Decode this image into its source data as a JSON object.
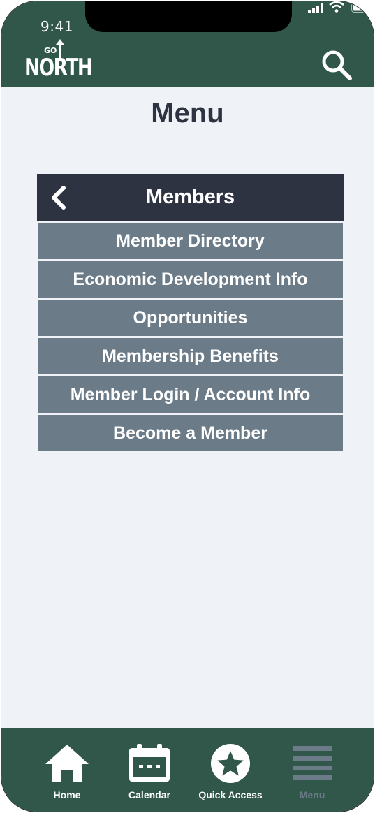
{
  "status_bar": {
    "time": "9:41"
  },
  "header": {
    "logo_small": "GO",
    "logo_main": "NORTH"
  },
  "page": {
    "title": "Menu"
  },
  "menu": {
    "section_title": "Members",
    "items": [
      {
        "label": "Member Directory"
      },
      {
        "label": "Economic Development Info"
      },
      {
        "label": "Opportunities"
      },
      {
        "label": "Membership Benefits"
      },
      {
        "label": "Member Login / Account Info"
      },
      {
        "label": "Become a Member"
      }
    ]
  },
  "tabs": [
    {
      "label": "Home",
      "icon": "home-icon"
    },
    {
      "label": "Calendar",
      "icon": "calendar-icon"
    },
    {
      "label": "Quick Access",
      "icon": "star-icon"
    },
    {
      "label": "Menu",
      "icon": "menu-icon",
      "active": true
    }
  ],
  "colors": {
    "brand_green": "#31564a",
    "header_dark": "#2e3342",
    "menu_item": "#6b7b88",
    "background": "#eff3f7"
  }
}
